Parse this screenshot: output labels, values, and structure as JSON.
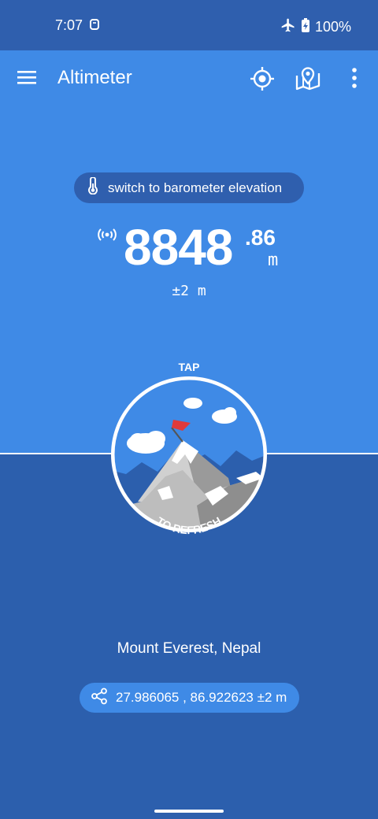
{
  "status_bar": {
    "time": "7:07",
    "battery": "100%",
    "icons": [
      "app-notification-icon",
      "airplane-mode-icon",
      "battery-charging-icon"
    ]
  },
  "app_bar": {
    "title": "Altimeter",
    "icons": [
      "menu-icon",
      "locate-icon",
      "map-icon",
      "more-icon"
    ]
  },
  "barometer_chip": {
    "label": "switch to barometer elevation",
    "icon": "thermometer-icon"
  },
  "elevation": {
    "integer": "8848",
    "decimal": ".86",
    "unit": "m",
    "accuracy": "±2 m",
    "icon": "gps-signal-icon"
  },
  "refresh": {
    "top_label": "TAP",
    "bottom_label": "TO REFRESH"
  },
  "location": {
    "name": "Mount Everest, Nepal",
    "coordinates": "27.986065 , 86.922623 ±2 m",
    "icon": "share-icon"
  },
  "colors": {
    "status_bar": "#2f5fae",
    "primary": "#3f8ae6",
    "dark": "#2c5fad",
    "flag": "#e03a3a"
  }
}
